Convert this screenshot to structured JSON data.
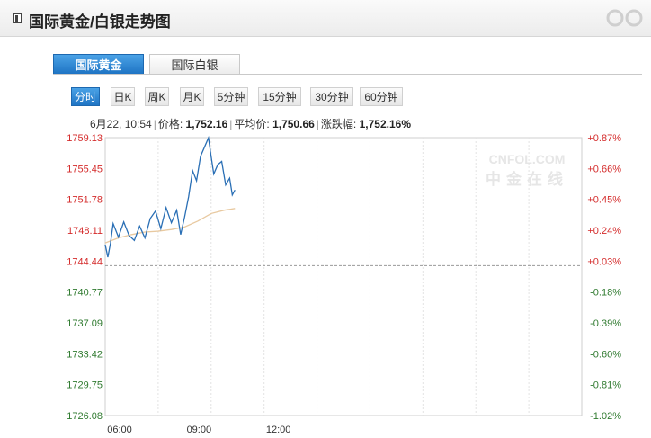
{
  "panel": {
    "title": "国际黄金/白银走势图"
  },
  "tabs": [
    {
      "label": "国际黄金",
      "active": true
    },
    {
      "label": "国际白银",
      "active": false
    }
  ],
  "periods": [
    {
      "label": "分时",
      "active": true
    },
    {
      "label": "日K",
      "active": false
    },
    {
      "label": "周K",
      "active": false
    },
    {
      "label": "月K",
      "active": false
    },
    {
      "label": "5分钟",
      "active": false
    },
    {
      "label": "15分钟",
      "active": false
    },
    {
      "label": "30分钟",
      "active": false
    },
    {
      "label": "60分钟",
      "active": false
    }
  ],
  "info": {
    "datetime": "6月22, 10:54",
    "price_label": "价格:",
    "price_value": "1,752.16",
    "avg_label": "平均价:",
    "avg_value": "1,750.66",
    "change_label": "涨跌幅:",
    "change_value": "1,752.16%"
  },
  "watermark": {
    "logo": "CNFOL.COM",
    "text": "中金在线"
  },
  "colors": {
    "price_line": "#2a6fb5",
    "avg_line": "#e8c9a0",
    "positive": "#d42b2b",
    "negative": "#2f7a2f",
    "tab_active": "#2a7fd0"
  },
  "chart_data": {
    "type": "line",
    "x_ticks": [
      "06:00",
      "09:00",
      "12:00"
    ],
    "y_ticks": [
      "1759.13",
      "1755.45",
      "1751.78",
      "1748.11",
      "1744.44",
      "1740.77",
      "1737.09",
      "1733.42",
      "1729.75",
      "1726.08"
    ],
    "right_ticks": [
      "+0.87%",
      "+0.66%",
      "+0.45%",
      "+0.24%",
      "+0.03%",
      "-0.18%",
      "-0.39%",
      "-0.60%",
      "-0.81%",
      "-1.02%"
    ],
    "ylim": [
      1726.08,
      1759.13
    ],
    "x_range_hours": [
      6,
      24
    ],
    "reference_price": 1743.9,
    "grid": true,
    "series": [
      {
        "x_hours": [
          6.0,
          6.1,
          6.2,
          6.3,
          6.5,
          6.7,
          6.9,
          7.1,
          7.3,
          7.5,
          7.7,
          7.9,
          8.1,
          8.3,
          8.5,
          8.7,
          8.85,
          9.0,
          9.15,
          9.3,
          9.45,
          9.6,
          9.75,
          9.9,
          10.0,
          10.1,
          10.25,
          10.4,
          10.55,
          10.7,
          10.8,
          10.9
        ],
        "values": [
          1746.4,
          1744.9,
          1746.6,
          1748.9,
          1747.3,
          1749.1,
          1747.5,
          1746.9,
          1748.6,
          1747.2,
          1749.5,
          1750.4,
          1748.3,
          1750.8,
          1749.0,
          1750.5,
          1747.6,
          1749.7,
          1752.1,
          1755.2,
          1754.0,
          1756.9,
          1758.0,
          1759.1,
          1756.9,
          1754.8,
          1755.9,
          1756.3,
          1753.5,
          1754.3,
          1752.3,
          1752.9
        ]
      },
      {
        "x_hours": [
          6.0,
          6.5,
          7.0,
          7.5,
          8.0,
          8.5,
          9.0,
          9.5,
          10.0,
          10.5,
          10.9
        ],
        "values": [
          1746.6,
          1747.2,
          1747.6,
          1747.9,
          1748.0,
          1748.2,
          1748.5,
          1749.2,
          1750.1,
          1750.5,
          1750.7
        ]
      }
    ]
  }
}
